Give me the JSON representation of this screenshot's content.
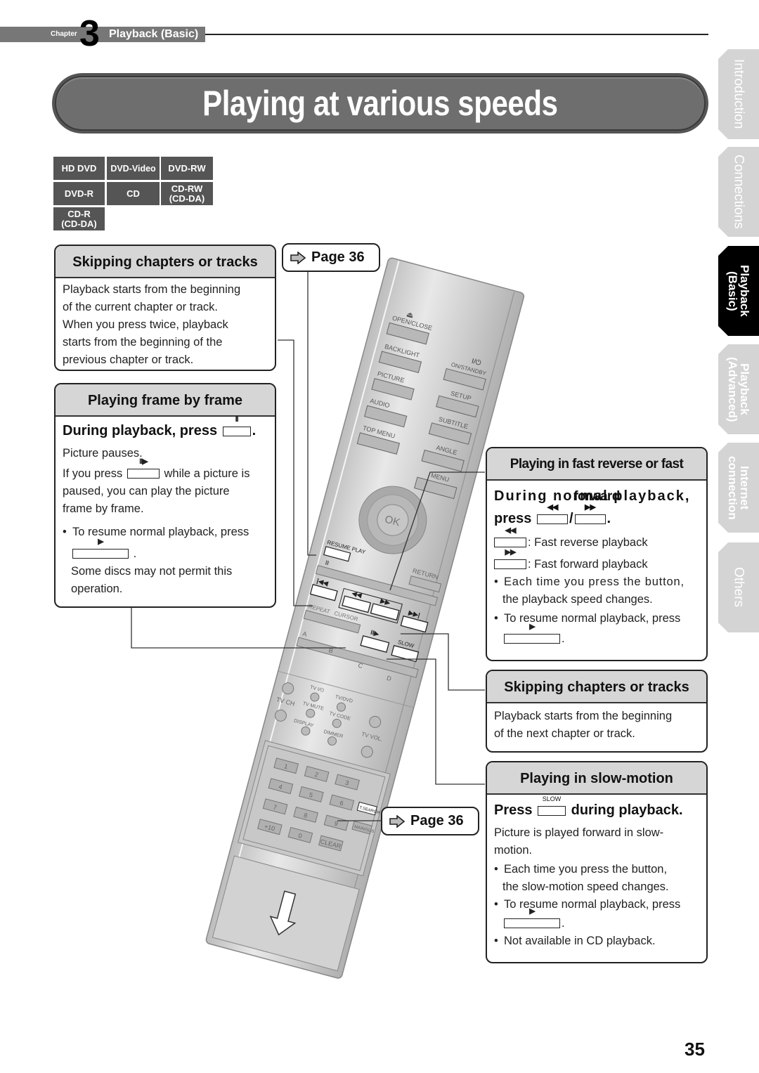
{
  "header": {
    "chapter_word": "Chapter",
    "chapter_number": "3",
    "chapter_title": "Playback (Basic)"
  },
  "title": "Playing at various speeds",
  "discs": [
    "HD DVD",
    "DVD-Video",
    "DVD-RW",
    "DVD-R",
    "CD",
    "CD-RW\n(CD-DA)",
    "CD-R\n(CD-DA)"
  ],
  "side_tabs": [
    {
      "label": "Introduction",
      "active": false
    },
    {
      "label": "Connections",
      "active": false
    },
    {
      "label": "Playback\n(Basic)",
      "active": true
    },
    {
      "label": "Playback\n(Advanced)",
      "active": false
    },
    {
      "label": "Internet\nconnection",
      "active": false
    },
    {
      "label": "Others",
      "active": false
    }
  ],
  "skip_prev": {
    "heading": "Skipping chapters or tracks",
    "body": [
      "Playback starts from the beginning",
      "of the current chapter or track.",
      "When you press twice, playback",
      "starts from the beginning of the",
      "previous chapter or track."
    ]
  },
  "page_ref_top": "Page 36",
  "frame_by_frame": {
    "heading": "Playing frame by frame",
    "lead": "During playback, press",
    "lead_key_symbol": "II",
    "p1": "Picture pauses.",
    "p2_before": "If you press",
    "p2_key_symbol": "II▶",
    "p2_after": "while a picture is",
    "p2_rest": [
      "paused, you can play the picture",
      "frame by frame."
    ],
    "bullet": "To resume normal playback, press",
    "resume_key_symbol": "▶",
    "note": [
      "Some discs may not permit this",
      "operation."
    ]
  },
  "fast": {
    "heading": "Playing in fast reverse or fast forward",
    "lead_line1": "During normal playback,",
    "lead_line2": "press",
    "rev_symbol": "◀◀",
    "fwd_symbol": "▶▶",
    "rev_desc": ": Fast reverse playback",
    "fwd_desc": ": Fast forward playback",
    "bullet1": [
      "Each time you press the button,",
      "the playback speed changes."
    ],
    "bullet2": "To resume normal playback, press",
    "resume_key_symbol": "▶"
  },
  "skip_next": {
    "heading": "Skipping chapters or tracks",
    "body": [
      "Playback starts from the beginning",
      "of the next chapter or track."
    ]
  },
  "slow": {
    "heading": "Playing in slow-motion",
    "lead_before": "Press",
    "key_symbol": "SLOW",
    "lead_after": "during playback.",
    "p1": [
      "Picture is played forward in slow-",
      "motion."
    ],
    "bullet1": [
      "Each time you press the button,",
      "the slow-motion speed changes."
    ],
    "bullet2": "To resume normal playback, press",
    "resume_key_symbol": "▶",
    "bullet3": "Not available in CD playback."
  },
  "page_ref_bottom": "Page 36",
  "remote": {
    "left_buttons": [
      "OPEN/CLOSE",
      "BACKLIGHT",
      "PICTURE",
      "AUDIO",
      "TOP MENU"
    ],
    "right_buttons": [
      "ON/STANDBY",
      "SETUP",
      "SUBTITLE",
      "ANGLE",
      "MENU"
    ],
    "eject_symbol": "⏏",
    "power_symbol": "I/⏻",
    "ok": "OK",
    "resume_play": "RESUME PLAY",
    "return": "RETURN",
    "repeat": "REPEAT",
    "cursor": "CURSOR",
    "slow": "SLOW",
    "abcd": [
      "A",
      "B",
      "C",
      "D"
    ],
    "tv_labels": [
      "TV I/⏻",
      "TV/DVD",
      "TV CH",
      "TV MUTE",
      "TV CODE",
      "DISPLAY",
      "DIMMER",
      "TV VOL."
    ],
    "keypad": [
      "1",
      "2",
      "3",
      "4",
      "5",
      "6",
      "7",
      "8",
      "9",
      "+10",
      "0",
      "CLEAR"
    ],
    "tsearch": "T.SEARCH",
    "mainsub": "MAIN/SUB"
  },
  "page_number": "35"
}
